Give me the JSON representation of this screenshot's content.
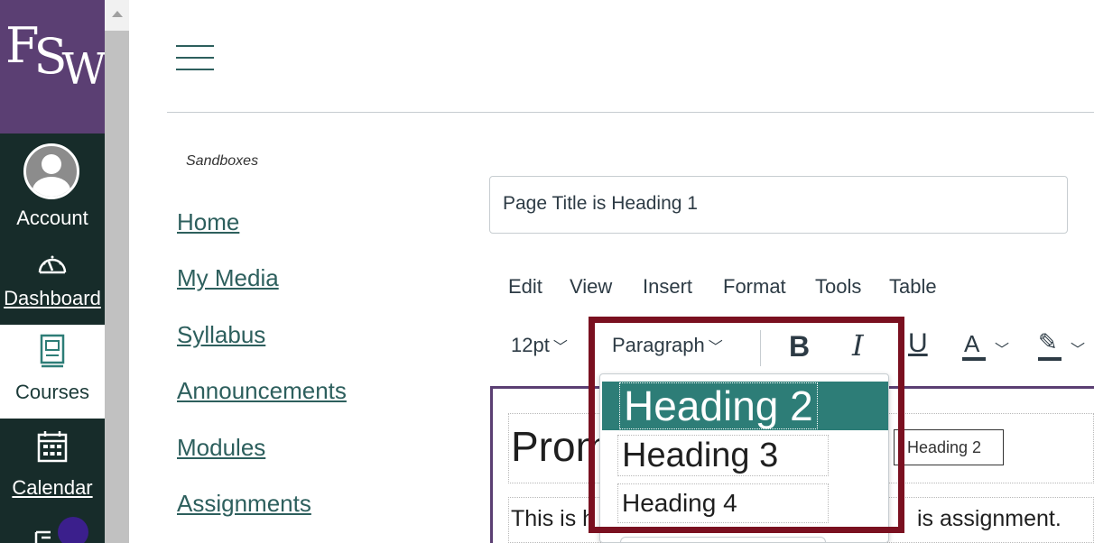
{
  "global_nav": {
    "logo_text": "FSW",
    "items": [
      {
        "label": "Account",
        "icon": "avatar"
      },
      {
        "label": "Dashboard",
        "icon": "dashboard-gauge-icon"
      },
      {
        "label": "Courses",
        "icon": "courses-book-icon"
      },
      {
        "label": "Calendar",
        "icon": "calendar-icon"
      },
      {
        "label": "",
        "icon": "inbox-icon"
      }
    ]
  },
  "colors": {
    "nav_bg": "#172c2a",
    "logo_bg": "#5b3f73",
    "link": "#2d5f5d",
    "dropdown_highlight": "#2d7d77",
    "annotation_frame": "#7a1020"
  },
  "course_nav": {
    "course_name": "Sandboxes",
    "links": [
      "Home",
      "My Media",
      "Syllabus",
      "Announcements",
      "Modules",
      "Assignments"
    ]
  },
  "editor": {
    "title_value": "Page Title is Heading 1",
    "menubar": [
      "Edit",
      "View",
      "Insert",
      "Format",
      "Tools",
      "Table"
    ],
    "toolbar": {
      "font_size": "12pt",
      "block_format": "Paragraph",
      "bold": "B",
      "italic": "I",
      "underline": "U",
      "text_color": "A",
      "highlight": "✎"
    },
    "content": {
      "heading_partial": "Prom",
      "heading_tag": "Heading 2",
      "body_left": "This is h",
      "body_right": "is assignment."
    }
  },
  "format_dropdown": {
    "options": [
      "Heading 2",
      "Heading 3",
      "Heading 4"
    ],
    "selected": "Heading 2"
  }
}
